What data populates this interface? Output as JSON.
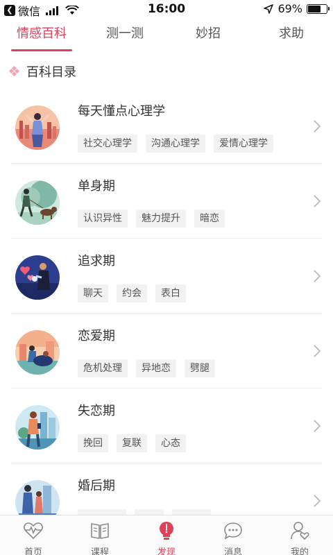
{
  "status_bar": {
    "carrier": "微信",
    "time": "16:00",
    "battery": "69%",
    "battery_level": 0.69
  },
  "tabs": [
    {
      "label": "情感百科",
      "active": true
    },
    {
      "label": "测一测",
      "active": false
    },
    {
      "label": "妙招",
      "active": false
    },
    {
      "label": "求助",
      "active": false
    }
  ],
  "section": {
    "title": "百科目录",
    "icon": "diamond-cluster-icon"
  },
  "categories": [
    {
      "title": "每天懂点心理学",
      "tags": [
        "社交心理学",
        "沟通心理学",
        "爱情心理学"
      ],
      "image": "woman-city-illustration"
    },
    {
      "title": "单身期",
      "tags": [
        "认识异性",
        "魅力提升",
        "暗恋"
      ],
      "image": "man-walking-dog-illustration"
    },
    {
      "title": "追求期",
      "tags": [
        "聊天",
        "约会",
        "表白"
      ],
      "image": "couple-hearts-illustration"
    },
    {
      "title": "恋爱期",
      "tags": [
        "危机处理",
        "异地恋",
        "劈腿"
      ],
      "image": "couple-sitting-illustration"
    },
    {
      "title": "失恋期",
      "tags": [
        "挽回",
        "复联",
        "心态"
      ],
      "image": "woman-phone-illustration"
    },
    {
      "title": "婚后期",
      "tags": [
        "",
        "",
        ""
      ],
      "image": "married-couple-illustration"
    }
  ],
  "bottom_nav": [
    {
      "label": "首页",
      "icon": "heartbeat-icon",
      "active": false
    },
    {
      "label": "课程",
      "icon": "open-book-icon",
      "active": false
    },
    {
      "label": "发现",
      "icon": "lightbulb-icon",
      "active": true
    },
    {
      "label": "消息",
      "icon": "chat-bubble-icon",
      "active": false
    },
    {
      "label": "我的",
      "icon": "user-heart-icon",
      "active": false
    }
  ],
  "colors": {
    "accent": "#e0405a",
    "tag_bg": "#f2f2f2",
    "divider": "#ececec"
  }
}
